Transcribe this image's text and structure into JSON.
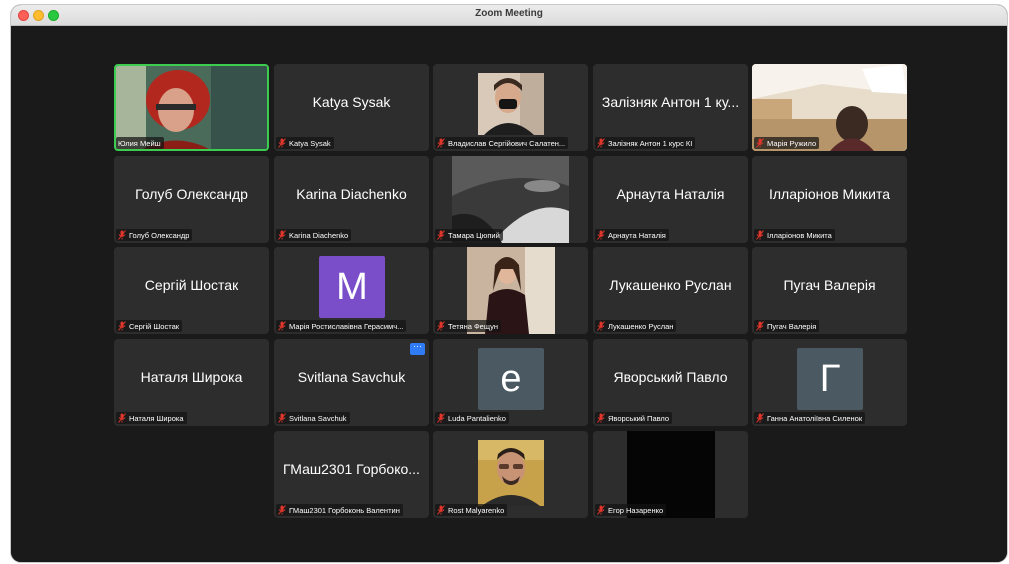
{
  "window": {
    "title": "Zoom Meeting"
  },
  "participants": [
    {
      "display": "",
      "name": "Юлия Мейш"
    },
    {
      "display": "Katya Sysak",
      "name": "Katya Sysak"
    },
    {
      "display": "",
      "name": "Владислав Сергійович Салатен..."
    },
    {
      "display": "Залізняк Антон 1 ку...",
      "name": "Залізняк Антон 1 курс КІ"
    },
    {
      "display": "",
      "name": "Марія Ружило"
    },
    {
      "display": "Голуб Олександр",
      "name": "Голуб Олександр"
    },
    {
      "display": "Karina Diachenko",
      "name": "Karina Diachenko"
    },
    {
      "display": "",
      "name": "Тамара Цюпий"
    },
    {
      "display": "Арнаута Наталія",
      "name": "Арнаута Наталія"
    },
    {
      "display": "Ілларіонов Микита",
      "name": "Ілларіонов Микита"
    },
    {
      "display": "Сергій Шостак",
      "name": "Сергій Шостак"
    },
    {
      "display": "M",
      "name": "Марія Ростиславівна Герасимч..."
    },
    {
      "display": "",
      "name": "Тетяна Фещун"
    },
    {
      "display": "Лукашенко Руслан",
      "name": "Лукашенко Руслан"
    },
    {
      "display": "Пугач Валерія",
      "name": "Пугач Валерія"
    },
    {
      "display": "Наталя Широка",
      "name": "Наталя Широка"
    },
    {
      "display": "Svitlana Savchuk",
      "name": "Svitlana Savchuk",
      "more": "···"
    },
    {
      "display": "e",
      "name": "Luda Pantalienko"
    },
    {
      "display": "Яворський Павло",
      "name": "Яворський Павло"
    },
    {
      "display": "Г",
      "name": "Ганна Анатоліївна Силенок"
    },
    {
      "display": "ГМаш2301 Горбоко...",
      "name": "ГМаш2301 Горбоконь Валентин"
    },
    {
      "display": "",
      "name": "Rost Malyarenko"
    },
    {
      "display": "",
      "name": "Егор Назаренко"
    }
  ],
  "colors": {
    "active_speaker": "#3bcc50",
    "tile_bg": "#2d2d2d",
    "avatar_m": "#7a4ec9",
    "avatar_slate": "#4a5962",
    "muted_mic": "#e0362c"
  },
  "icons": {
    "muted": "mic-muted-icon",
    "more": "more-options-icon"
  }
}
